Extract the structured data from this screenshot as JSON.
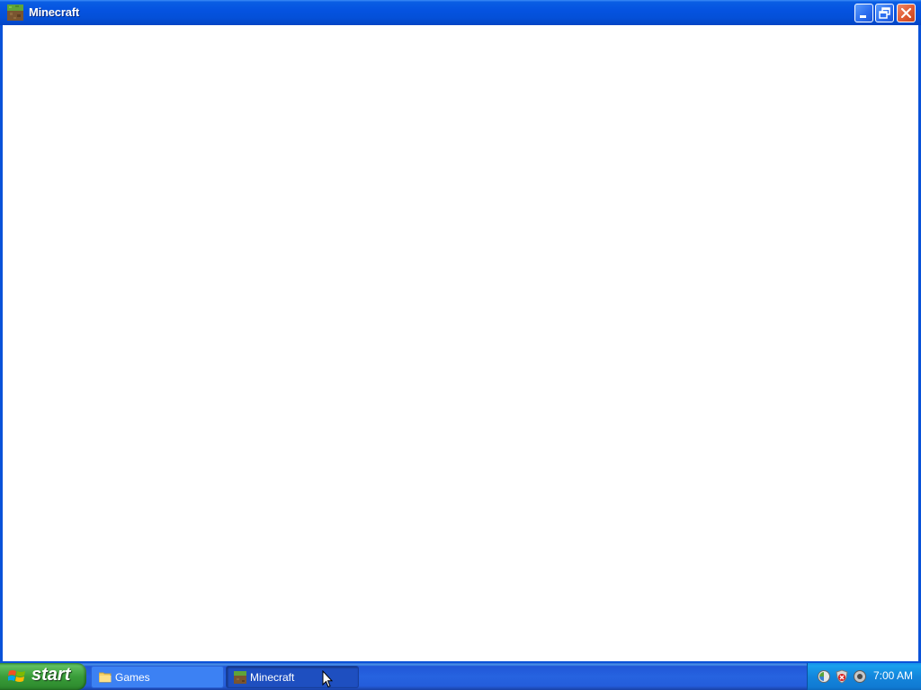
{
  "window": {
    "title": "Minecraft",
    "icon": "minecraft-grass-block-icon",
    "controls": [
      "minimize",
      "restore",
      "close"
    ]
  },
  "taskbar": {
    "start_label": "start",
    "buttons": [
      {
        "label": "Games",
        "icon": "folder-icon",
        "active": false
      },
      {
        "label": "Minecraft",
        "icon": "minecraft-grass-block-icon",
        "active": true
      }
    ],
    "tray": {
      "icons": [
        "network-icon",
        "security-alert-icon",
        "volume-icon"
      ],
      "clock": "7:00 AM"
    }
  },
  "colors": {
    "titlebar": "#0553e0",
    "taskbar": "#245ddb",
    "start_button": "#3a9d3a",
    "tray": "#1386dc",
    "client_background": "#ffffff"
  }
}
